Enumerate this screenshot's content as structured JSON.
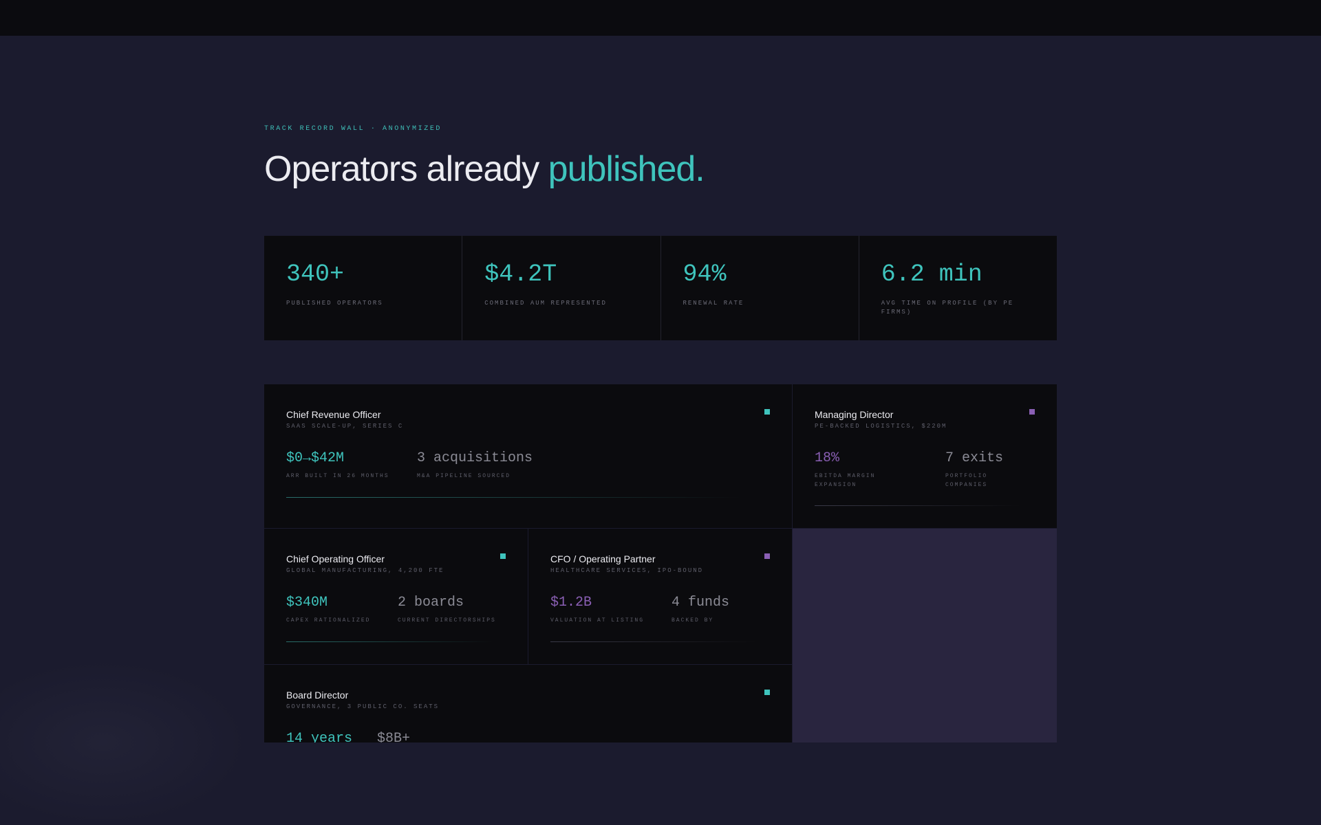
{
  "colors": {
    "accent_teal": "#3fc4bd",
    "accent_purple": "#8a5fb4",
    "bg": "#1b1b2e",
    "card_bg": "#0b0b0e"
  },
  "eyebrow": "TRACK RECORD WALL · ANONYMIZED",
  "headline": {
    "prefix": "Operators already",
    "accent": "published."
  },
  "stats": [
    {
      "value": "340+",
      "label": "PUBLISHED OPERATORS"
    },
    {
      "value": "$4.2T",
      "label": "COMBINED AUM REPRESENTED"
    },
    {
      "value": "94%",
      "label": "RENEWAL RATE"
    },
    {
      "value": "6.2 min",
      "label": "AVG TIME ON PROFILE (BY PE FIRMS)"
    }
  ],
  "cards": [
    {
      "title": "Chief Revenue Officer",
      "subtitle": "SAAS SCALE-UP, SERIES C",
      "marker": "square-teal-icon",
      "metrics": [
        {
          "value": "$0→$42M",
          "label": "ARR BUILT IN 26 MONTHS"
        },
        {
          "value": "3 acquisitions",
          "label": "M&A PIPELINE SOURCED"
        }
      ]
    },
    {
      "title": "Managing Director",
      "subtitle": "PE-BACKED LOGISTICS, $220M",
      "marker": "square-purple-icon",
      "metrics": [
        {
          "value": "18%",
          "label": "EBITDA MARGIN EXPANSION"
        },
        {
          "value": "7 exits",
          "label": "PORTFOLIO COMPANIES"
        }
      ]
    },
    {
      "title": "Chief Operating Officer",
      "subtitle": "GLOBAL MANUFACTURING, 4,200 FTE",
      "marker": "square-teal-icon",
      "metrics": [
        {
          "value": "$340M",
          "label": "CAPEX RATIONALIZED"
        },
        {
          "value": "2 boards",
          "label": "CURRENT DIRECTORSHIPS"
        }
      ]
    },
    {
      "title": "CFO / Operating Partner",
      "subtitle": "HEALTHCARE SERVICES, IPO-BOUND",
      "marker": "square-purple-icon",
      "metrics": [
        {
          "value": "$1.2B",
          "label": "VALUATION AT LISTING"
        },
        {
          "value": "4 funds",
          "label": "BACKED BY"
        }
      ]
    },
    {
      "title": "Board Director",
      "subtitle": "GOVERNANCE, 3 PUBLIC CO. SEATS",
      "marker": "square-teal-icon",
      "metrics": [
        {
          "value": "14 years",
          "label": ""
        },
        {
          "value": "$8B+",
          "label": ""
        }
      ]
    }
  ]
}
